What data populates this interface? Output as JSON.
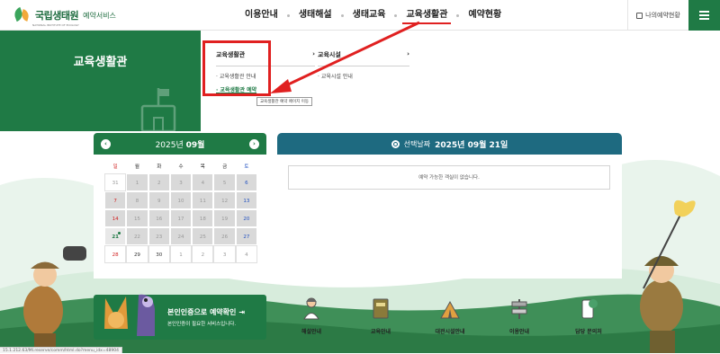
{
  "logo": {
    "title": "국립생태원",
    "sub": "예약서비스",
    "en": "NATIONAL INSTITUTE OF ECOLOGY"
  },
  "nav": [
    "이용안내",
    "생태해설",
    "생태교육",
    "교육생활관",
    "예약현황"
  ],
  "nav_active_index": 3,
  "my_reservation": "나의예약현황",
  "hero_title": "교육생활관",
  "dropdown": {
    "col1": {
      "head": "교육생활관",
      "arrow": "›",
      "links": [
        "교육생활관 안내",
        "교육생활관 예약"
      ]
    },
    "col2": {
      "head": "교육시설",
      "arrow": "›",
      "links": [
        "교육시설 안내"
      ]
    }
  },
  "tooltip": "교육생활관 예약 페이지 이동",
  "calendar": {
    "prev": "‹",
    "next": "›",
    "year": "2025년",
    "month": "09월",
    "weekdays": [
      "일",
      "월",
      "화",
      "수",
      "목",
      "금",
      "토"
    ],
    "weeks": [
      [
        "31",
        "1",
        "2",
        "3",
        "4",
        "5",
        "6"
      ],
      [
        "7",
        "8",
        "9",
        "10",
        "11",
        "12",
        "13"
      ],
      [
        "14",
        "15",
        "16",
        "17",
        "18",
        "19",
        "20"
      ],
      [
        "21",
        "22",
        "23",
        "24",
        "25",
        "26",
        "27"
      ],
      [
        "28",
        "29",
        "30",
        "1",
        "2",
        "3",
        "4"
      ]
    ]
  },
  "reservation": {
    "label": "선택날짜",
    "date": "2025년 09월 21일",
    "empty": "예약 가능한 객실이 없습니다."
  },
  "auth": {
    "title": "본인인증으로 예약확인",
    "sub": "본인인증이 필요한 서비스입니다."
  },
  "services": [
    {
      "label": "해설안내",
      "icon": "guide-person-icon"
    },
    {
      "label": "교육안내",
      "icon": "book-icon"
    },
    {
      "label": "대관시설안내",
      "icon": "tent-icon"
    },
    {
      "label": "이용안내",
      "icon": "signpost-icon"
    },
    {
      "label": "담당 문의처",
      "icon": "phone-chat-icon"
    }
  ],
  "status_url": "15.1.212.63/MI.reserve/comm/html.do?menu_idx=48904"
}
